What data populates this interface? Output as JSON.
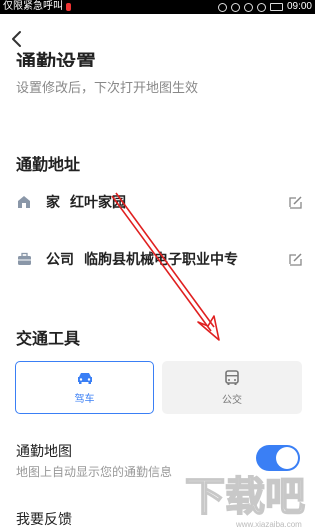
{
  "status_bar": {
    "carrier_text": "仅限紧急呼叫",
    "time": "09:00"
  },
  "header": {
    "title": "通勤设置",
    "subtitle": "设置修改后，下次打开地图生效"
  },
  "commute_address": {
    "section_title": "通勤地址",
    "items": [
      {
        "label": "家",
        "value": "红叶家园",
        "icon": "home-icon"
      },
      {
        "label": "公司",
        "value": "临朐县机械电子职业中专",
        "icon": "briefcase-icon"
      }
    ]
  },
  "transport": {
    "section_title": "交通工具",
    "options": [
      {
        "label": "驾车",
        "icon": "car-icon",
        "selected": true
      },
      {
        "label": "公交",
        "icon": "bus-icon",
        "selected": false
      }
    ]
  },
  "commute_map": {
    "title": "通勤地图",
    "subtitle": "地图上自动显示您的通勤信息",
    "enabled": true
  },
  "feedback": {
    "title": "我要反馈"
  },
  "colors": {
    "accent": "#3a7ff5",
    "annotation_arrow": "#e02020"
  },
  "watermark": {
    "text": "下载吧",
    "site": "www.xiazaiba.com"
  }
}
